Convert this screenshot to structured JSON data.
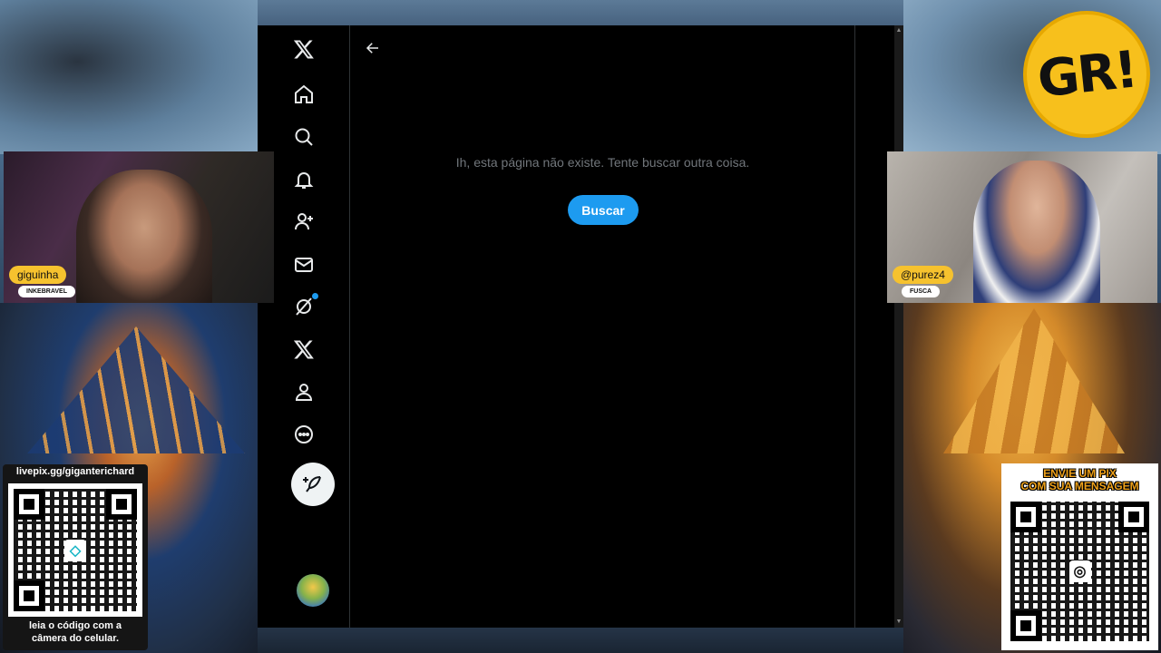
{
  "stream": {
    "logo_text": "GR!",
    "cam_left": {
      "name": "giguinha",
      "subtitle": "INKEBRAVEL"
    },
    "cam_right": {
      "name": "@purez4",
      "subtitle": "FUSCA"
    },
    "pix_left": {
      "url": "livepix.gg/giganterichard",
      "caption_line1": "leia o código com a",
      "caption_line2": "câmera do celular."
    },
    "pix_right": {
      "headline_line1": "ENVIE UM PIX",
      "headline_line2": "COM SUA MENSAGEM"
    }
  },
  "x_app": {
    "sidebar": {
      "items": [
        {
          "name": "x-logo",
          "icon": "x-logo-icon"
        },
        {
          "name": "home",
          "icon": "home-icon"
        },
        {
          "name": "explore",
          "icon": "search-icon"
        },
        {
          "name": "notifications",
          "icon": "bell-icon"
        },
        {
          "name": "follow",
          "icon": "add-user-icon"
        },
        {
          "name": "messages",
          "icon": "mail-icon"
        },
        {
          "name": "grok",
          "icon": "grok-icon"
        },
        {
          "name": "premium",
          "icon": "x-logo-icon"
        },
        {
          "name": "profile",
          "icon": "person-icon"
        },
        {
          "name": "more",
          "icon": "more-icon"
        }
      ],
      "post_button_icon": "feather-plus-icon"
    },
    "main": {
      "error_message": "Ih, esta página não existe. Tente buscar outra coisa.",
      "search_button_label": "Buscar"
    },
    "colors": {
      "background": "#000000",
      "accent": "#1d9bf0",
      "muted_text": "#71767b",
      "border": "#2f3336"
    }
  }
}
